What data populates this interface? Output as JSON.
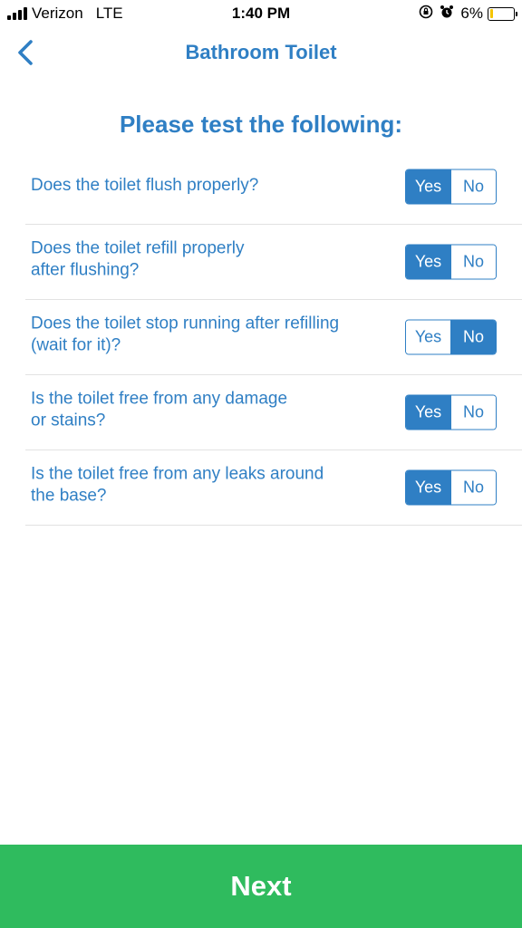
{
  "status_bar": {
    "carrier": "Verizon",
    "network": "LTE",
    "time": "1:40 PM",
    "battery_percent": "6%",
    "icons": [
      "signal-bars-icon",
      "rotation-lock-icon",
      "alarm-icon",
      "battery-icon"
    ]
  },
  "nav": {
    "back_icon": "chevron-left-icon",
    "title": "Bathroom Toilet"
  },
  "heading": "Please test the following:",
  "toggle_labels": {
    "yes": "Yes",
    "no": "No"
  },
  "questions": [
    {
      "text": "Does the toilet flush properly?",
      "selected": "yes"
    },
    {
      "text": "Does the toilet refill properly\nafter flushing?",
      "selected": "yes"
    },
    {
      "text": "Does the toilet stop running after refilling\n(wait for it)?",
      "selected": "no"
    },
    {
      "text": "Is the toilet free from any damage\nor stains?",
      "selected": "yes"
    },
    {
      "text": "Is the toilet free from any leaks around\nthe base?",
      "selected": "yes"
    }
  ],
  "next_label": "Next",
  "colors": {
    "accent": "#2f7fc4",
    "next_button": "#2fbb5e",
    "battery_low": "#f5c400"
  }
}
